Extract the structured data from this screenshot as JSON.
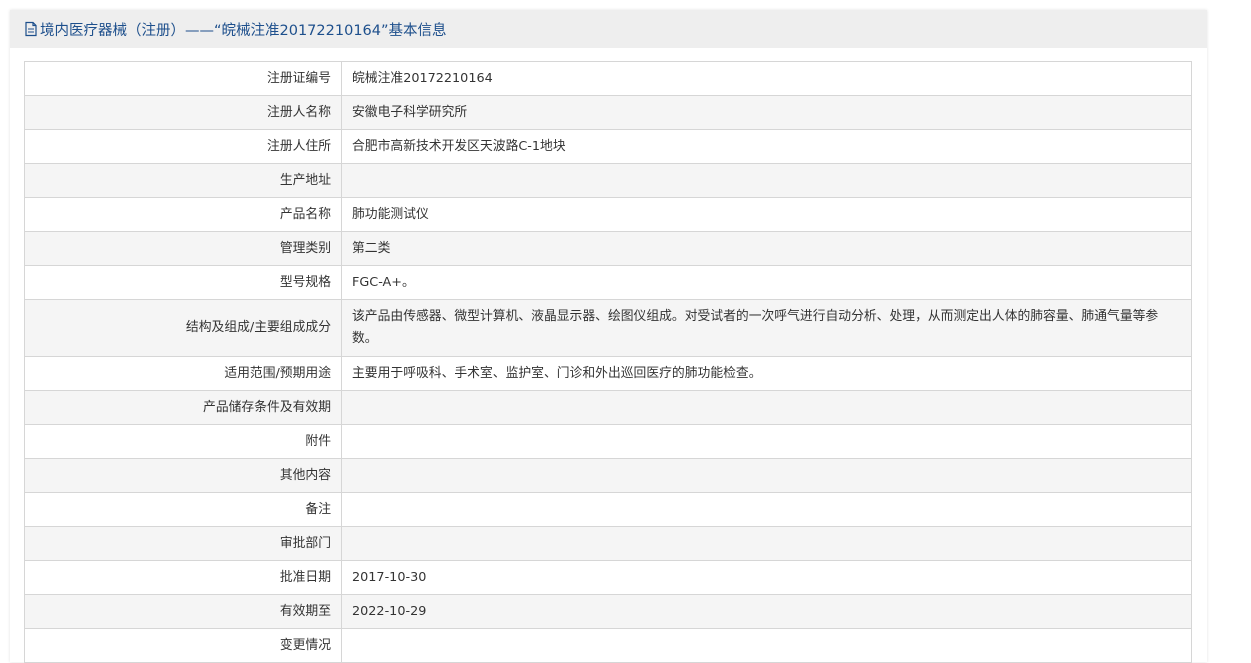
{
  "header": {
    "icon": "document-icon",
    "title": "境内医疗器械（注册）——“皖械注准20172210164”基本信息"
  },
  "rows": [
    {
      "label": "注册证编号",
      "value": "皖械注准20172210164"
    },
    {
      "label": "注册人名称",
      "value": "安徽电子科学研究所"
    },
    {
      "label": "注册人住所",
      "value": "合肥市高新技术开发区天波路C-1地块"
    },
    {
      "label": "生产地址",
      "value": ""
    },
    {
      "label": "产品名称",
      "value": "肺功能测试仪"
    },
    {
      "label": "管理类别",
      "value": "第二类"
    },
    {
      "label": "型号规格",
      "value": "FGC-A+。"
    },
    {
      "label": "结构及组成/主要组成成分",
      "value": "该产品由传感器、微型计算机、液晶显示器、绘图仪组成。对受试者的一次呼气进行自动分析、处理，从而测定出人体的肺容量、肺通气量等参数。"
    },
    {
      "label": "适用范围/预期用途",
      "value": "主要用于呼吸科、手术室、监护室、门诊和外出巡回医疗的肺功能检查。"
    },
    {
      "label": "产品储存条件及有效期",
      "value": ""
    },
    {
      "label": "附件",
      "value": ""
    },
    {
      "label": "其他内容",
      "value": ""
    },
    {
      "label": "备注",
      "value": ""
    },
    {
      "label": "审批部门",
      "value": ""
    },
    {
      "label": "批准日期",
      "value": "2017-10-30"
    },
    {
      "label": "有效期至",
      "value": "2022-10-29"
    },
    {
      "label": "变更情况",
      "value": ""
    }
  ]
}
